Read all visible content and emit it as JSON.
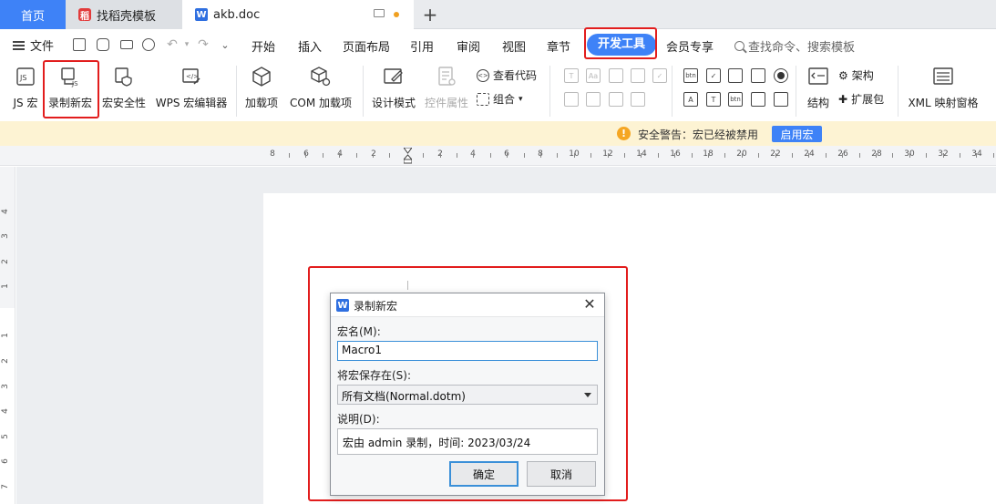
{
  "tabs": {
    "home": "首页",
    "template": "找稻壳模板",
    "document": "akb.doc"
  },
  "menu": {
    "file": "文件",
    "items": [
      "开始",
      "插入",
      "页面布局",
      "引用",
      "审阅",
      "视图",
      "章节",
      "开发工具",
      "会员专享"
    ],
    "search_placeholder": "查找命令、搜索模板"
  },
  "ribbon": {
    "js_macro": "JS 宏",
    "record_macro": "录制新宏",
    "macro_security": "宏安全性",
    "wps_macro_editor": "WPS 宏编辑器",
    "addins": "加载项",
    "com_addins": "COM 加载项",
    "design_mode": "设计模式",
    "control_props": "控件属性",
    "view_code": "查看代码",
    "group": "组合",
    "structure": "结构",
    "schema": "架构",
    "expansion": "扩展包",
    "xml_mapping": "XML 映射窗格"
  },
  "warning": {
    "text": "安全警告：宏已经被禁用",
    "button": "启用宏"
  },
  "ruler_labels": [
    "8",
    "6",
    "4",
    "2",
    "2",
    "4",
    "6",
    "8",
    "10",
    "12",
    "14",
    "16",
    "18",
    "20",
    "22",
    "24",
    "26",
    "28",
    "30",
    "32",
    "34"
  ],
  "vruler_labels": [
    "4",
    "3",
    "2",
    "1",
    "1",
    "2",
    "3",
    "4",
    "5",
    "6",
    "7"
  ],
  "dialog": {
    "title": "录制新宏",
    "name_label": "宏名(M):",
    "name_value": "Macro1",
    "store_label": "将宏保存在(S):",
    "store_value": "所有文档(Normal.dotm)",
    "desc_label": "说明(D):",
    "desc_value": "宏由 admin 录制，时间: 2023/03/24",
    "ok": "确定",
    "cancel": "取消"
  },
  "colors": {
    "accent": "#3e82f7",
    "warning_bg": "#fdf3d3",
    "highlight_red": "#e21d1d"
  }
}
